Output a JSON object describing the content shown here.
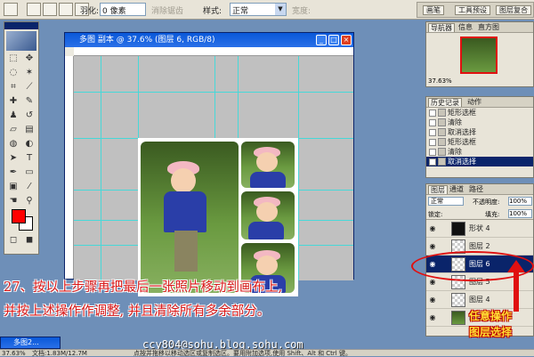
{
  "options_bar": {
    "feather_label": "羽化:",
    "feather_value": "0 像素",
    "antialias_label": "消除锯齿",
    "style_label": "样式:",
    "style_value": "正常",
    "width_label": "宽度:",
    "palette_tabs": [
      "画笔",
      "工具预设",
      "图层复合"
    ]
  },
  "document": {
    "title": "多图 副本 @ 37.6% (图层 6, RGB/8)",
    "win_min": "_",
    "win_max": "□",
    "win_close": "×"
  },
  "navigator": {
    "tabs": [
      "导航器",
      "信息",
      "直方图"
    ],
    "zoom": "37.63%"
  },
  "history": {
    "tabs": [
      "历史记录",
      "动作"
    ],
    "items": [
      "矩形选框",
      "清除",
      "取消选择",
      "矩形选框",
      "清除",
      "取消选择"
    ]
  },
  "layers": {
    "tabs": [
      "图层",
      "通道",
      "路径"
    ],
    "blend_mode": "正常",
    "opacity_label": "不透明度:",
    "opacity_value": "100%",
    "lock_label": "锁定:",
    "fill_label": "填充:",
    "fill_value": "100%",
    "rows": [
      "形状 4",
      "图层 2",
      "图层 6",
      "图层 5",
      "图层 4",
      "图层 3"
    ]
  },
  "annotation": {
    "line1": "27、按以上步骤再把最后一张照片移动到画布上,",
    "line2": "并按上述操作作调整, 并且清除所有多余部分。",
    "callout_line1": "任意操作",
    "callout_line2": "图层选择",
    "watermark": "ccy804@sohu.blog.sohu.com"
  },
  "minimized_window": "多图2...",
  "status": {
    "zoom": "37.63%",
    "doc": "文档:1.83M/12.7M",
    "hint": "点按并拖移以移动选区或复制选区。要用附加选项,使用 Shift、Alt 和 Ctrl 键。"
  },
  "colors": {
    "foreground": "#ff0000",
    "background": "#ffffff",
    "annotation": "#d81818",
    "guide": "#47d8d8"
  }
}
